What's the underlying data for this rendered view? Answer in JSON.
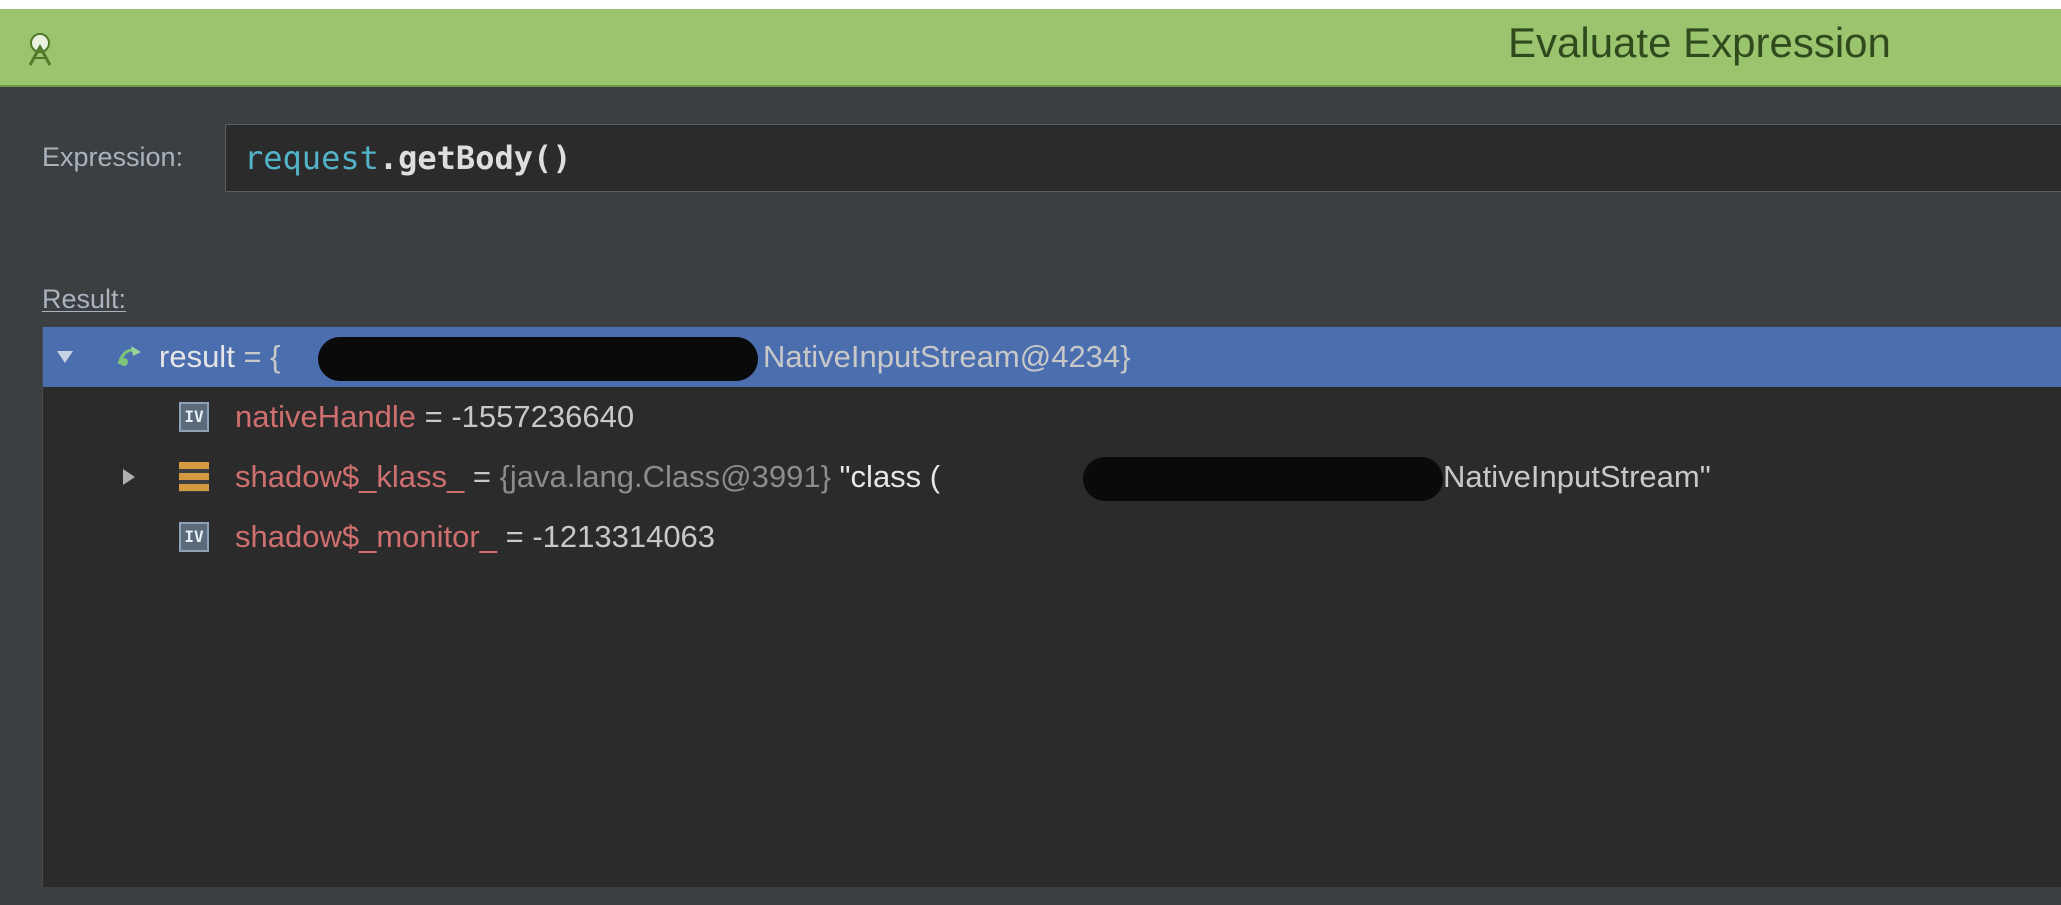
{
  "window": {
    "title": "Evaluate Expression",
    "title_color": "#9bc46f",
    "app_icon": "android-studio-icon"
  },
  "expression": {
    "label": "Expression:",
    "tokens": {
      "object": "request",
      "separator": ".",
      "method": "getBody()"
    }
  },
  "result": {
    "label": "Result:",
    "root": {
      "name": "result",
      "prefix": "= {",
      "value_suffix": "NativeInputStream@4234}",
      "icon": "watch-result-icon",
      "expanded": true
    },
    "children": [
      {
        "name": "nativeHandle",
        "operator": "=",
        "value": "-1557236640",
        "icon": "primitive-field-icon",
        "icon_text": "IV"
      },
      {
        "name": "shadow$_klass_",
        "operator": "=",
        "type_ref": "{java.lang.Class@3991}",
        "value_prefix": "\"class (",
        "value_suffix": "NativeInputStream\"",
        "icon": "object-field-icon",
        "expanded": false
      },
      {
        "name": "shadow$_monitor_",
        "operator": "=",
        "value": "-1213314063",
        "icon": "primitive-field-icon",
        "icon_text": "IV"
      }
    ]
  },
  "colors": {
    "selection": "#4b6eaf",
    "field_name": "#cf6f6f",
    "background": "#2b2b2b"
  }
}
